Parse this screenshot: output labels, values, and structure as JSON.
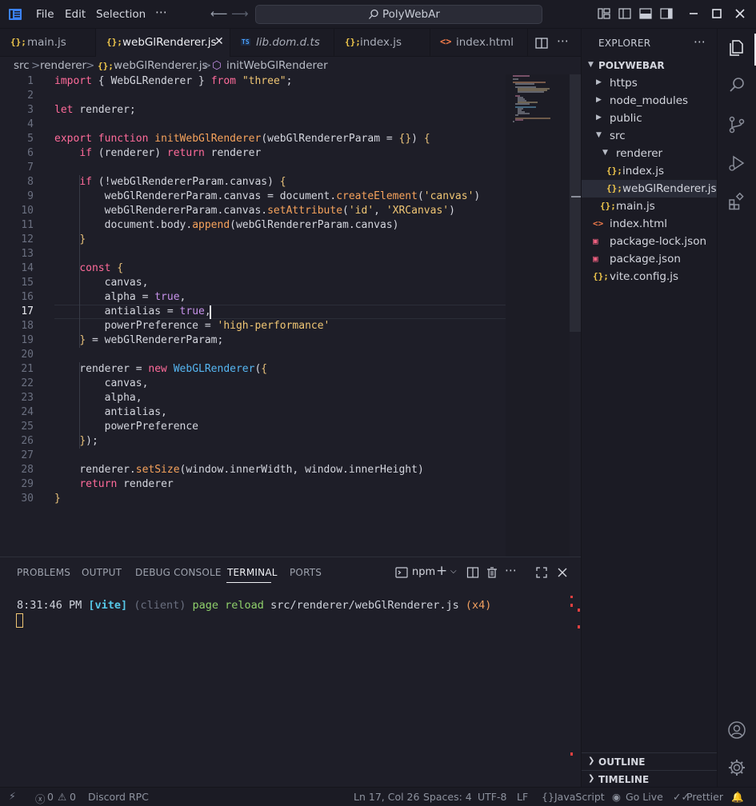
{
  "menu": {
    "file": "File",
    "edit": "Edit",
    "selection": "Selection",
    "more": "⋯"
  },
  "search": {
    "text": "PolyWebAr"
  },
  "tabs": [
    {
      "icon": "{};",
      "label": "main.js"
    },
    {
      "icon": "{};",
      "label": "webGlRenderer.js"
    },
    {
      "icon": "TS",
      "label": "lib.dom.d.ts"
    },
    {
      "icon": "{};",
      "label": "index.js"
    },
    {
      "icon": "<>",
      "label": "index.html"
    }
  ],
  "breadcrumb": {
    "p1": "src",
    "p2": "renderer",
    "p3": "webGlRenderer.js",
    "p4": "initWebGlRenderer",
    "sep": ">"
  },
  "code": {
    "ln": [
      "1",
      "2",
      "3",
      "4",
      "5",
      "6",
      "7",
      "8",
      "9",
      "10",
      "11",
      "12",
      "13",
      "14",
      "15",
      "16",
      "17",
      "18",
      "19",
      "20",
      "21",
      "22",
      "23",
      "24",
      "25",
      "26",
      "27",
      "28",
      "29",
      "30"
    ]
  },
  "panel": {
    "tabs": {
      "problems": "PROBLEMS",
      "output": "OUTPUT",
      "debug": "DEBUG CONSOLE",
      "terminal": "TERMINAL",
      "ports": "PORTS"
    },
    "shell": "npm",
    "terminal": {
      "time": "8:31:46 PM",
      "vite": "[vite]",
      "client": "(client)",
      "msg": "page reload",
      "path": "src/renderer/webGlRenderer.js",
      "count": "(x4)"
    }
  },
  "explorer": {
    "title": "EXPLORER",
    "more": "⋯",
    "root": "POLYWEBAR",
    "items": {
      "https": "https",
      "node_modules": "node_modules",
      "public": "public",
      "src": "src",
      "renderer": "renderer",
      "index_js": "index.js",
      "webgl_js": "webGlRenderer.js",
      "main_js": "main.js",
      "index_html": "index.html",
      "pkg_lock": "package-lock.json",
      "pkg": "package.json",
      "vite_cfg": "vite.config.js"
    },
    "outline": "OUTLINE",
    "timeline": "TIMELINE"
  },
  "status": {
    "errors": "0",
    "warnings": "0",
    "discord": "Discord RPC",
    "position": "Ln 17, Col 26",
    "spaces": "Spaces: 4",
    "encoding": "UTF-8",
    "eol": "LF",
    "language": "JavaScript",
    "golive": "Go Live",
    "prettier": "Prettier"
  },
  "colors": {
    "accent": "#f2c94c",
    "keyword": "#ff6b9a",
    "string": "#f0c674",
    "function": "#f7a35c",
    "class": "#56b6f2"
  }
}
